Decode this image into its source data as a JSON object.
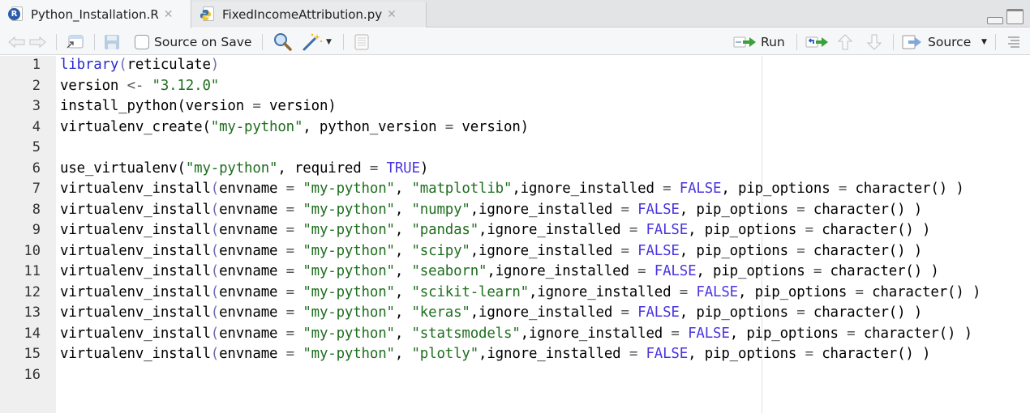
{
  "tabs": [
    {
      "label": "Python_Installation.R",
      "icon": "r-file-icon",
      "active": true
    },
    {
      "label": "FixedIncomeAttribution.py",
      "icon": "python-file-icon",
      "active": false
    }
  ],
  "toolbar": {
    "source_on_save_label": "Source on Save",
    "source_on_save_checked": false,
    "run_label": "Run",
    "source_label": "Source"
  },
  "editor": {
    "lines": [
      {
        "n": "1",
        "tokens": [
          [
            "fn",
            "library"
          ],
          [
            "paren",
            "("
          ],
          [
            "t",
            "reticulate"
          ],
          [
            "paren",
            ")"
          ]
        ]
      },
      {
        "n": "2",
        "tokens": [
          [
            "t",
            "version "
          ],
          [
            "op",
            "<-"
          ],
          [
            "t",
            " "
          ],
          [
            "str",
            "\"3.12.0\""
          ]
        ]
      },
      {
        "n": "3",
        "tokens": [
          [
            "t",
            "install_python(version "
          ],
          [
            "op",
            "="
          ],
          [
            "t",
            " version)"
          ]
        ]
      },
      {
        "n": "4",
        "tokens": [
          [
            "t",
            "virtualenv_create("
          ],
          [
            "str",
            "\"my-python\""
          ],
          [
            "t",
            ", python_version "
          ],
          [
            "op",
            "="
          ],
          [
            "t",
            " version)"
          ]
        ]
      },
      {
        "n": "5",
        "tokens": []
      },
      {
        "n": "6",
        "tokens": [
          [
            "t",
            "use_virtualenv("
          ],
          [
            "str",
            "\"my-python\""
          ],
          [
            "t",
            ", required "
          ],
          [
            "op",
            "="
          ],
          [
            "t",
            " "
          ],
          [
            "const",
            "TRUE"
          ],
          [
            "t",
            ")"
          ]
        ]
      },
      {
        "n": "7",
        "tokens": [
          [
            "t",
            "virtualenv_install"
          ],
          [
            "paren",
            "("
          ],
          [
            "t",
            "envname "
          ],
          [
            "op",
            "="
          ],
          [
            "t",
            " "
          ],
          [
            "str",
            "\"my-python\""
          ],
          [
            "t",
            ", "
          ],
          [
            "str",
            "\"matplotlib\""
          ],
          [
            "t",
            ",ignore_installed "
          ],
          [
            "op",
            "="
          ],
          [
            "t",
            " "
          ],
          [
            "const",
            "FALSE"
          ],
          [
            "t",
            ", pip_options "
          ],
          [
            "op",
            "="
          ],
          [
            "t",
            " character() )"
          ]
        ]
      },
      {
        "n": "8",
        "tokens": [
          [
            "t",
            "virtualenv_install"
          ],
          [
            "paren",
            "("
          ],
          [
            "t",
            "envname "
          ],
          [
            "op",
            "="
          ],
          [
            "t",
            " "
          ],
          [
            "str",
            "\"my-python\""
          ],
          [
            "t",
            ", "
          ],
          [
            "str",
            "\"numpy\""
          ],
          [
            "t",
            ",ignore_installed "
          ],
          [
            "op",
            "="
          ],
          [
            "t",
            " "
          ],
          [
            "const",
            "FALSE"
          ],
          [
            "t",
            ", pip_options "
          ],
          [
            "op",
            "="
          ],
          [
            "t",
            " character() )"
          ]
        ]
      },
      {
        "n": "9",
        "tokens": [
          [
            "t",
            "virtualenv_install"
          ],
          [
            "paren",
            "("
          ],
          [
            "t",
            "envname "
          ],
          [
            "op",
            "="
          ],
          [
            "t",
            " "
          ],
          [
            "str",
            "\"my-python\""
          ],
          [
            "t",
            ", "
          ],
          [
            "str",
            "\"pandas\""
          ],
          [
            "t",
            ",ignore_installed "
          ],
          [
            "op",
            "="
          ],
          [
            "t",
            " "
          ],
          [
            "const",
            "FALSE"
          ],
          [
            "t",
            ", pip_options "
          ],
          [
            "op",
            "="
          ],
          [
            "t",
            " character() )"
          ]
        ]
      },
      {
        "n": "10",
        "tokens": [
          [
            "t",
            "virtualenv_install"
          ],
          [
            "paren",
            "("
          ],
          [
            "t",
            "envname "
          ],
          [
            "op",
            "="
          ],
          [
            "t",
            " "
          ],
          [
            "str",
            "\"my-python\""
          ],
          [
            "t",
            ", "
          ],
          [
            "str",
            "\"scipy\""
          ],
          [
            "t",
            ",ignore_installed "
          ],
          [
            "op",
            "="
          ],
          [
            "t",
            " "
          ],
          [
            "const",
            "FALSE"
          ],
          [
            "t",
            ", pip_options "
          ],
          [
            "op",
            "="
          ],
          [
            "t",
            " character() )"
          ]
        ]
      },
      {
        "n": "11",
        "tokens": [
          [
            "t",
            "virtualenv_install"
          ],
          [
            "paren",
            "("
          ],
          [
            "t",
            "envname "
          ],
          [
            "op",
            "="
          ],
          [
            "t",
            " "
          ],
          [
            "str",
            "\"my-python\""
          ],
          [
            "t",
            ", "
          ],
          [
            "str",
            "\"seaborn\""
          ],
          [
            "t",
            ",ignore_installed "
          ],
          [
            "op",
            "="
          ],
          [
            "t",
            " "
          ],
          [
            "const",
            "FALSE"
          ],
          [
            "t",
            ", pip_options "
          ],
          [
            "op",
            "="
          ],
          [
            "t",
            " character() )"
          ]
        ]
      },
      {
        "n": "12",
        "tokens": [
          [
            "t",
            "virtualenv_install"
          ],
          [
            "paren",
            "("
          ],
          [
            "t",
            "envname "
          ],
          [
            "op",
            "="
          ],
          [
            "t",
            " "
          ],
          [
            "str",
            "\"my-python\""
          ],
          [
            "t",
            ", "
          ],
          [
            "str",
            "\"scikit-learn\""
          ],
          [
            "t",
            ",ignore_installed "
          ],
          [
            "op",
            "="
          ],
          [
            "t",
            " "
          ],
          [
            "const",
            "FALSE"
          ],
          [
            "t",
            ", pip_options "
          ],
          [
            "op",
            "="
          ],
          [
            "t",
            " character() )"
          ]
        ]
      },
      {
        "n": "13",
        "tokens": [
          [
            "t",
            "virtualenv_install"
          ],
          [
            "paren",
            "("
          ],
          [
            "t",
            "envname "
          ],
          [
            "op",
            "="
          ],
          [
            "t",
            " "
          ],
          [
            "str",
            "\"my-python\""
          ],
          [
            "t",
            ", "
          ],
          [
            "str",
            "\"keras\""
          ],
          [
            "t",
            ",ignore_installed "
          ],
          [
            "op",
            "="
          ],
          [
            "t",
            " "
          ],
          [
            "const",
            "FALSE"
          ],
          [
            "t",
            ", pip_options "
          ],
          [
            "op",
            "="
          ],
          [
            "t",
            " character() )"
          ]
        ]
      },
      {
        "n": "14",
        "tokens": [
          [
            "t",
            "virtualenv_install"
          ],
          [
            "paren",
            "("
          ],
          [
            "t",
            "envname "
          ],
          [
            "op",
            "="
          ],
          [
            "t",
            " "
          ],
          [
            "str",
            "\"my-python\""
          ],
          [
            "t",
            ", "
          ],
          [
            "str",
            "\"statsmodels\""
          ],
          [
            "t",
            ",ignore_installed "
          ],
          [
            "op",
            "="
          ],
          [
            "t",
            " "
          ],
          [
            "const",
            "FALSE"
          ],
          [
            "t",
            ", pip_options "
          ],
          [
            "op",
            "="
          ],
          [
            "t",
            " character() )"
          ]
        ]
      },
      {
        "n": "15",
        "tokens": [
          [
            "t",
            "virtualenv_install"
          ],
          [
            "paren",
            "("
          ],
          [
            "t",
            "envname "
          ],
          [
            "op",
            "="
          ],
          [
            "t",
            " "
          ],
          [
            "str",
            "\"my-python\""
          ],
          [
            "t",
            ", "
          ],
          [
            "str",
            "\"plotly\""
          ],
          [
            "t",
            ",ignore_installed "
          ],
          [
            "op",
            "="
          ],
          [
            "t",
            " "
          ],
          [
            "const",
            "FALSE"
          ],
          [
            "t",
            ", pip_options "
          ],
          [
            "op",
            "="
          ],
          [
            "t",
            " character() )"
          ]
        ]
      },
      {
        "n": "16",
        "tokens": []
      }
    ]
  }
}
